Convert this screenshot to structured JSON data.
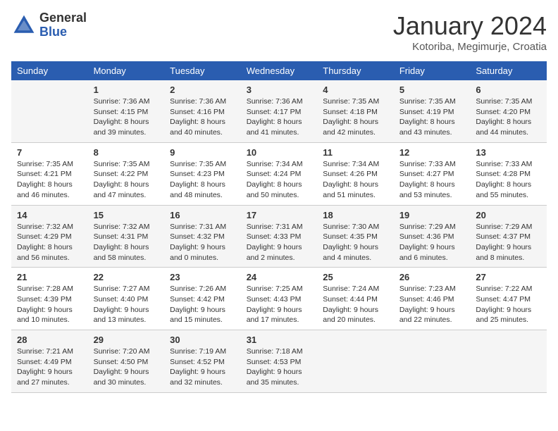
{
  "header": {
    "logo_line1": "General",
    "logo_line2": "Blue",
    "month_title": "January 2024",
    "location": "Kotoriba, Megimurje, Croatia"
  },
  "weekdays": [
    "Sunday",
    "Monday",
    "Tuesday",
    "Wednesday",
    "Thursday",
    "Friday",
    "Saturday"
  ],
  "weeks": [
    [
      {
        "day": "",
        "info": ""
      },
      {
        "day": "1",
        "info": "Sunrise: 7:36 AM\nSunset: 4:15 PM\nDaylight: 8 hours\nand 39 minutes."
      },
      {
        "day": "2",
        "info": "Sunrise: 7:36 AM\nSunset: 4:16 PM\nDaylight: 8 hours\nand 40 minutes."
      },
      {
        "day": "3",
        "info": "Sunrise: 7:36 AM\nSunset: 4:17 PM\nDaylight: 8 hours\nand 41 minutes."
      },
      {
        "day": "4",
        "info": "Sunrise: 7:35 AM\nSunset: 4:18 PM\nDaylight: 8 hours\nand 42 minutes."
      },
      {
        "day": "5",
        "info": "Sunrise: 7:35 AM\nSunset: 4:19 PM\nDaylight: 8 hours\nand 43 minutes."
      },
      {
        "day": "6",
        "info": "Sunrise: 7:35 AM\nSunset: 4:20 PM\nDaylight: 8 hours\nand 44 minutes."
      }
    ],
    [
      {
        "day": "7",
        "info": "Sunrise: 7:35 AM\nSunset: 4:21 PM\nDaylight: 8 hours\nand 46 minutes."
      },
      {
        "day": "8",
        "info": "Sunrise: 7:35 AM\nSunset: 4:22 PM\nDaylight: 8 hours\nand 47 minutes."
      },
      {
        "day": "9",
        "info": "Sunrise: 7:35 AM\nSunset: 4:23 PM\nDaylight: 8 hours\nand 48 minutes."
      },
      {
        "day": "10",
        "info": "Sunrise: 7:34 AM\nSunset: 4:24 PM\nDaylight: 8 hours\nand 50 minutes."
      },
      {
        "day": "11",
        "info": "Sunrise: 7:34 AM\nSunset: 4:26 PM\nDaylight: 8 hours\nand 51 minutes."
      },
      {
        "day": "12",
        "info": "Sunrise: 7:33 AM\nSunset: 4:27 PM\nDaylight: 8 hours\nand 53 minutes."
      },
      {
        "day": "13",
        "info": "Sunrise: 7:33 AM\nSunset: 4:28 PM\nDaylight: 8 hours\nand 55 minutes."
      }
    ],
    [
      {
        "day": "14",
        "info": "Sunrise: 7:32 AM\nSunset: 4:29 PM\nDaylight: 8 hours\nand 56 minutes."
      },
      {
        "day": "15",
        "info": "Sunrise: 7:32 AM\nSunset: 4:31 PM\nDaylight: 8 hours\nand 58 minutes."
      },
      {
        "day": "16",
        "info": "Sunrise: 7:31 AM\nSunset: 4:32 PM\nDaylight: 9 hours\nand 0 minutes."
      },
      {
        "day": "17",
        "info": "Sunrise: 7:31 AM\nSunset: 4:33 PM\nDaylight: 9 hours\nand 2 minutes."
      },
      {
        "day": "18",
        "info": "Sunrise: 7:30 AM\nSunset: 4:35 PM\nDaylight: 9 hours\nand 4 minutes."
      },
      {
        "day": "19",
        "info": "Sunrise: 7:29 AM\nSunset: 4:36 PM\nDaylight: 9 hours\nand 6 minutes."
      },
      {
        "day": "20",
        "info": "Sunrise: 7:29 AM\nSunset: 4:37 PM\nDaylight: 9 hours\nand 8 minutes."
      }
    ],
    [
      {
        "day": "21",
        "info": "Sunrise: 7:28 AM\nSunset: 4:39 PM\nDaylight: 9 hours\nand 10 minutes."
      },
      {
        "day": "22",
        "info": "Sunrise: 7:27 AM\nSunset: 4:40 PM\nDaylight: 9 hours\nand 13 minutes."
      },
      {
        "day": "23",
        "info": "Sunrise: 7:26 AM\nSunset: 4:42 PM\nDaylight: 9 hours\nand 15 minutes."
      },
      {
        "day": "24",
        "info": "Sunrise: 7:25 AM\nSunset: 4:43 PM\nDaylight: 9 hours\nand 17 minutes."
      },
      {
        "day": "25",
        "info": "Sunrise: 7:24 AM\nSunset: 4:44 PM\nDaylight: 9 hours\nand 20 minutes."
      },
      {
        "day": "26",
        "info": "Sunrise: 7:23 AM\nSunset: 4:46 PM\nDaylight: 9 hours\nand 22 minutes."
      },
      {
        "day": "27",
        "info": "Sunrise: 7:22 AM\nSunset: 4:47 PM\nDaylight: 9 hours\nand 25 minutes."
      }
    ],
    [
      {
        "day": "28",
        "info": "Sunrise: 7:21 AM\nSunset: 4:49 PM\nDaylight: 9 hours\nand 27 minutes."
      },
      {
        "day": "29",
        "info": "Sunrise: 7:20 AM\nSunset: 4:50 PM\nDaylight: 9 hours\nand 30 minutes."
      },
      {
        "day": "30",
        "info": "Sunrise: 7:19 AM\nSunset: 4:52 PM\nDaylight: 9 hours\nand 32 minutes."
      },
      {
        "day": "31",
        "info": "Sunrise: 7:18 AM\nSunset: 4:53 PM\nDaylight: 9 hours\nand 35 minutes."
      },
      {
        "day": "",
        "info": ""
      },
      {
        "day": "",
        "info": ""
      },
      {
        "day": "",
        "info": ""
      }
    ]
  ]
}
